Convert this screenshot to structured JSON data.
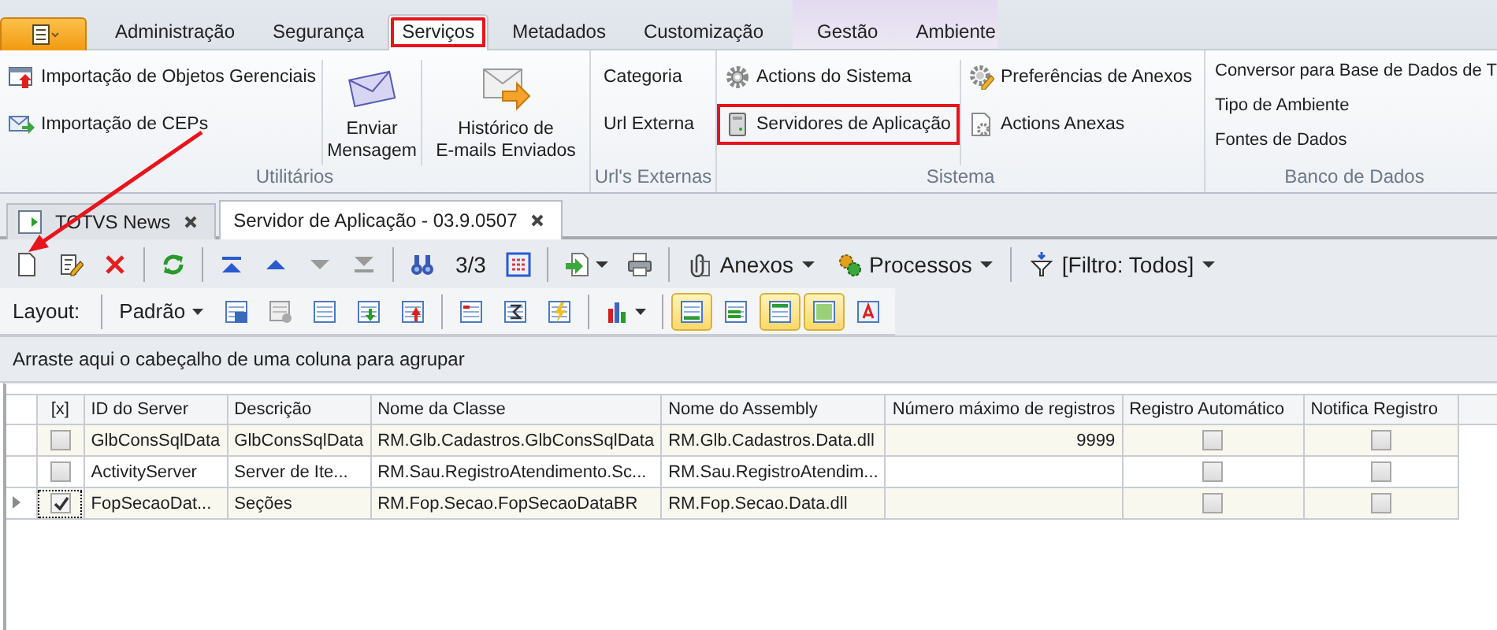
{
  "ribbon_tabs": [
    {
      "label": "Administração",
      "selected": false,
      "highlighted": false,
      "contextual": false
    },
    {
      "label": "Segurança",
      "selected": false,
      "highlighted": false,
      "contextual": false
    },
    {
      "label": "Serviços",
      "selected": true,
      "highlighted": true,
      "contextual": false
    },
    {
      "label": "Metadados",
      "selected": false,
      "highlighted": false,
      "contextual": false
    },
    {
      "label": "Customização",
      "selected": false,
      "highlighted": false,
      "contextual": false
    },
    {
      "label": "Gestão",
      "selected": false,
      "highlighted": false,
      "contextual": true
    },
    {
      "label": "Ambiente",
      "selected": false,
      "highlighted": false,
      "contextual": true
    }
  ],
  "ribbon_groups": [
    {
      "label": "Utilitários",
      "columns": [
        [
          {
            "label": "Importação de Objetos Gerenciais",
            "kind": "small",
            "highlighted": false
          },
          {
            "label": "Importação de CEPs",
            "kind": "small",
            "highlighted": false
          }
        ],
        [
          {
            "label": "Enviar\nMensagem",
            "kind": "large",
            "highlighted": false
          }
        ],
        [
          {
            "label": "Histórico de\nE-mails Enviados",
            "kind": "large",
            "highlighted": false
          }
        ]
      ]
    },
    {
      "label": "Url's Externas",
      "columns": [
        [
          {
            "label": "Categoria",
            "kind": "text",
            "highlighted": false
          },
          {
            "label": "Url Externa",
            "kind": "text",
            "highlighted": false
          }
        ]
      ]
    },
    {
      "label": "Sistema",
      "columns": [
        [
          {
            "label": "Actions do Sistema",
            "kind": "small",
            "highlighted": false
          },
          {
            "label": "Servidores de Aplicação",
            "kind": "small",
            "highlighted": true
          }
        ],
        [
          {
            "label": "Preferências de Anexos",
            "kind": "small",
            "highlighted": false
          },
          {
            "label": "Actions Anexas",
            "kind": "small",
            "highlighted": false
          }
        ]
      ]
    },
    {
      "label": "Banco de Dados",
      "columns": [
        [
          {
            "label": "Conversor para Base de Dados de T",
            "kind": "compact",
            "highlighted": false
          },
          {
            "label": "Tipo de Ambiente",
            "kind": "compact",
            "highlighted": false
          },
          {
            "label": "Fontes de Dados",
            "kind": "compact",
            "highlighted": false
          }
        ]
      ]
    }
  ],
  "document_tabs": [
    {
      "label": "TOTVS News",
      "selected": false
    },
    {
      "label": "Servidor de Aplicação - 03.9.0507",
      "selected": true
    }
  ],
  "grid_toolbar": {
    "navigation": [
      {
        "disabled": false
      },
      {
        "disabled": false
      },
      {
        "disabled": true
      },
      {
        "disabled": true
      }
    ],
    "record_counter": "3/3",
    "menus": [
      "Anexos",
      "Processos",
      "[Filtro: Todos]"
    ]
  },
  "layout_toolbar": {
    "label": "Layout:",
    "layout_menu": "Padrão",
    "view_toggles": [
      {
        "selected": true
      },
      {
        "selected": false
      },
      {
        "selected": true
      },
      {
        "selected": true
      },
      {
        "selected": false
      }
    ]
  },
  "group_panel": {
    "text": "Arraste aqui o cabeçalho de uma coluna para agrupar"
  },
  "grid": {
    "check_column": "[x]",
    "columns": [
      "ID do Server",
      "Descrição",
      "Nome da Classe",
      "Nome do Assembly",
      "Número máximo de registros",
      "Registro Automático",
      "Notifica Registro"
    ],
    "rows": [
      {
        "selected": false,
        "checked": false,
        "cells": [
          "GlbConsSqlData",
          "GlbConsSqlData",
          "RM.Glb.Cadastros.GlbConsSqlData",
          "RM.Glb.Cadastros.Data.dll",
          "9999"
        ],
        "registro_automatico": false,
        "notifica_registro": false
      },
      {
        "selected": false,
        "checked": false,
        "cells": [
          "ActivityServer",
          "Server de Ite...",
          "RM.Sau.RegistroAtendimento.Sc...",
          "RM.Sau.RegistroAtendim...",
          ""
        ],
        "registro_automatico": false,
        "notifica_registro": false
      },
      {
        "selected": true,
        "checked": true,
        "cells": [
          "FopSecaoDat...",
          "Seções",
          "RM.Fop.Secao.FopSecaoDataBR",
          "RM.Fop.Secao.Data.dll",
          ""
        ],
        "registro_automatico": false,
        "notifica_registro": false
      }
    ]
  }
}
